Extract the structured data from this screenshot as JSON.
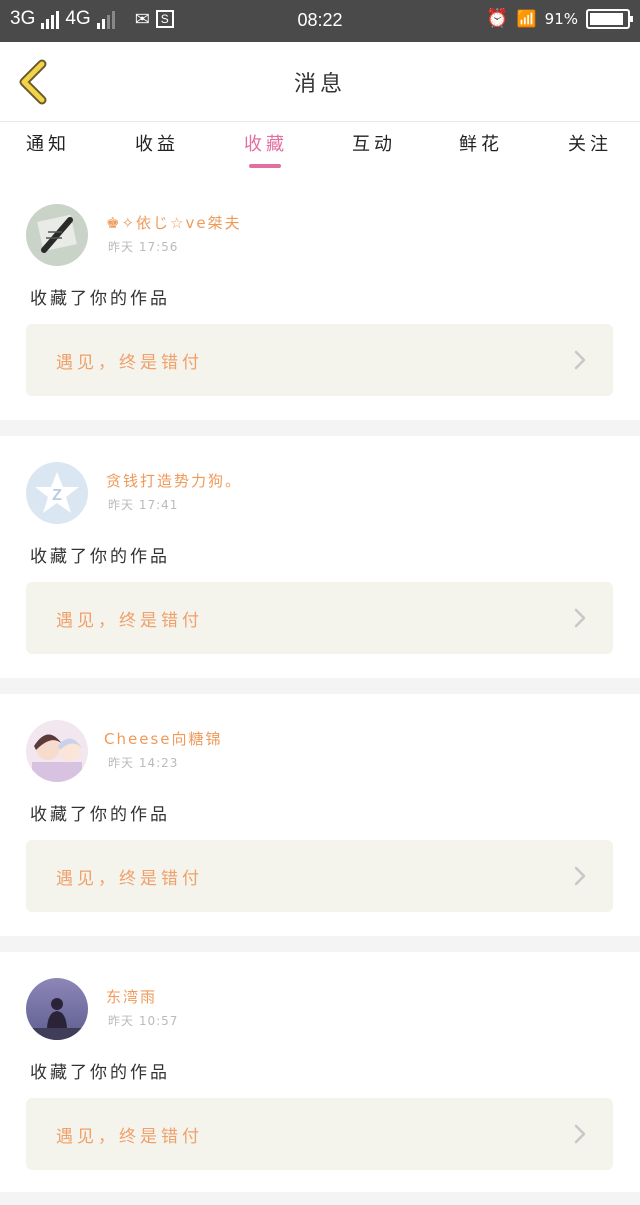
{
  "statusbar": {
    "net1": "3G",
    "net2": "4G",
    "time": "08:22",
    "battery_text": "91%",
    "battery_level": 0.91
  },
  "header": {
    "title": "消息"
  },
  "tabs": [
    "通知",
    "收益",
    "收藏",
    "互动",
    "鲜花",
    "关注"
  ],
  "active_tab_index": 2,
  "messages": [
    {
      "username": "♚✧依じ☆ve桀夫",
      "time": "昨天 17:56",
      "action": "收藏了你的作品",
      "work_title": "遇见，终是错付"
    },
    {
      "username": "贪钱打造势力狗。",
      "time": "昨天 17:41",
      "action": "收藏了你的作品",
      "work_title": "遇见，终是错付"
    },
    {
      "username": "Cheese向糖锦",
      "time": "昨天 14:23",
      "action": "收藏了你的作品",
      "work_title": "遇见，终是错付"
    },
    {
      "username": "东湾雨",
      "time": "昨天 10:57",
      "action": "收藏了你的作品",
      "work_title": "遇见，终是错付"
    }
  ],
  "colors": {
    "accent": "#e36fa0",
    "username": "#f09a5a",
    "work_title": "#f0a06a",
    "back_icon": "#f2d34b"
  }
}
